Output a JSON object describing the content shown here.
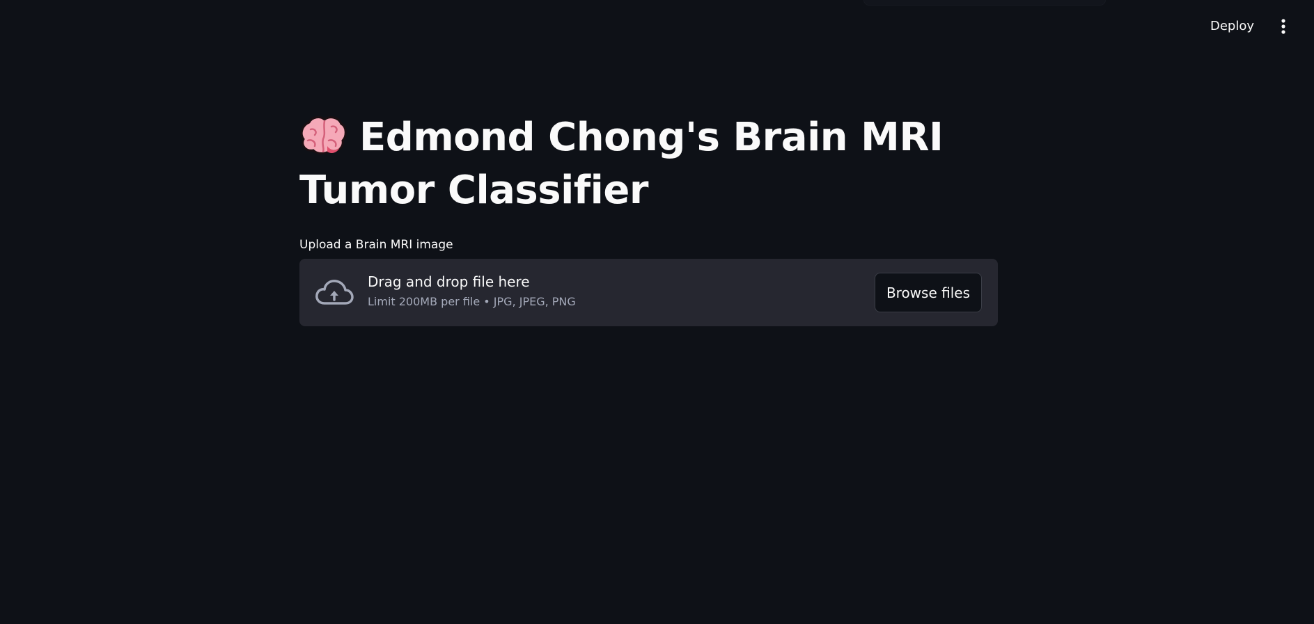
{
  "header": {
    "deploy_label": "Deploy",
    "menu_icon": "kebab-vertical-icon"
  },
  "main": {
    "title_icon": "brain-icon",
    "title": "Edmond Chong's Brain MRI Tumor Classifier",
    "uploader": {
      "label": "Upload a Brain MRI image",
      "drop_text": "Drag and drop file here",
      "limit_text": "Limit 200MB per file • JPG, JPEG, PNG",
      "browse_label": "Browse files",
      "icon": "cloud-upload-icon"
    }
  },
  "colors": {
    "background": "#0e1117",
    "dropzone": "#262730",
    "text": "#fafafa",
    "muted_text": "#a3a8b8"
  }
}
